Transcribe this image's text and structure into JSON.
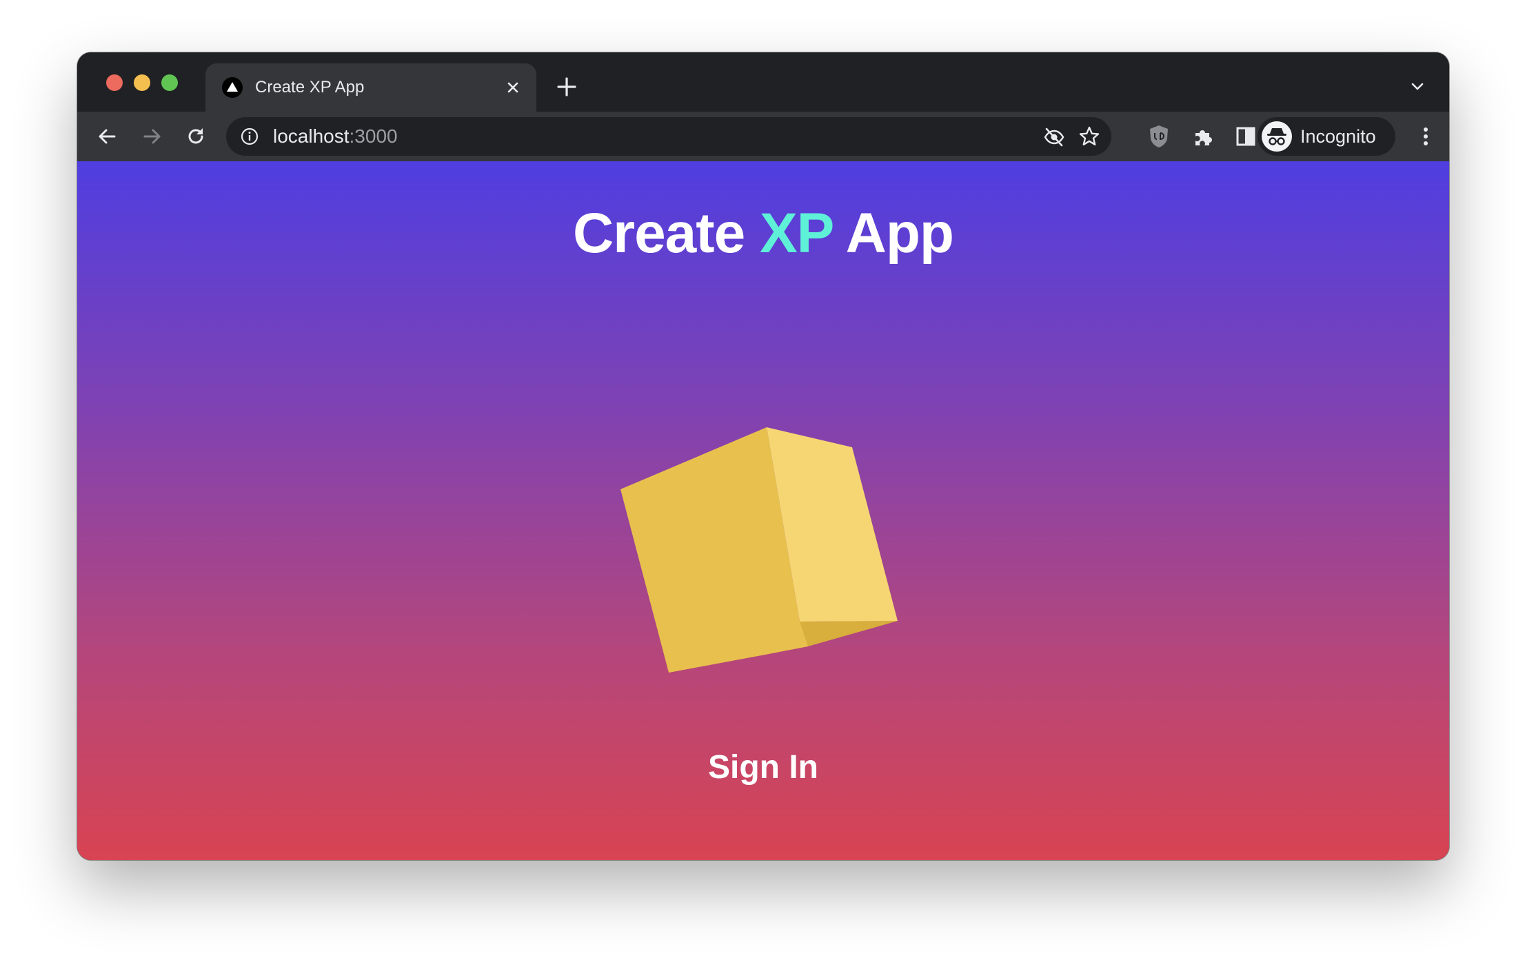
{
  "browser": {
    "tab": {
      "title": "Create XP App"
    },
    "omnibox": {
      "host": "localhost",
      "port": ":3000"
    },
    "profile": {
      "label": "Incognito"
    },
    "icons": {
      "favicon": "triangle-logo-icon",
      "close": "close-icon",
      "new_tab": "plus-icon",
      "tab_menu": "chevron-down-icon",
      "back": "arrow-left-icon",
      "forward": "arrow-right-icon",
      "reload": "reload-icon",
      "site_info": "info-icon",
      "eye": "eye-off-icon",
      "star": "star-icon",
      "ublock": "shield-icon",
      "extensions": "puzzle-icon",
      "side_panel": "side-panel-icon",
      "incognito": "incognito-icon",
      "menu": "more-vert-icon"
    }
  },
  "page": {
    "title": {
      "part1": "Create ",
      "accent": "XP",
      "part2": " App"
    },
    "cta": "Sign In",
    "colors": {
      "gradient_top": "#4f3ee0",
      "gradient_bottom": "#d84452",
      "accent": "#5ff1d8",
      "cube_front": "#e8c04e",
      "cube_side": "#f5d672"
    }
  }
}
